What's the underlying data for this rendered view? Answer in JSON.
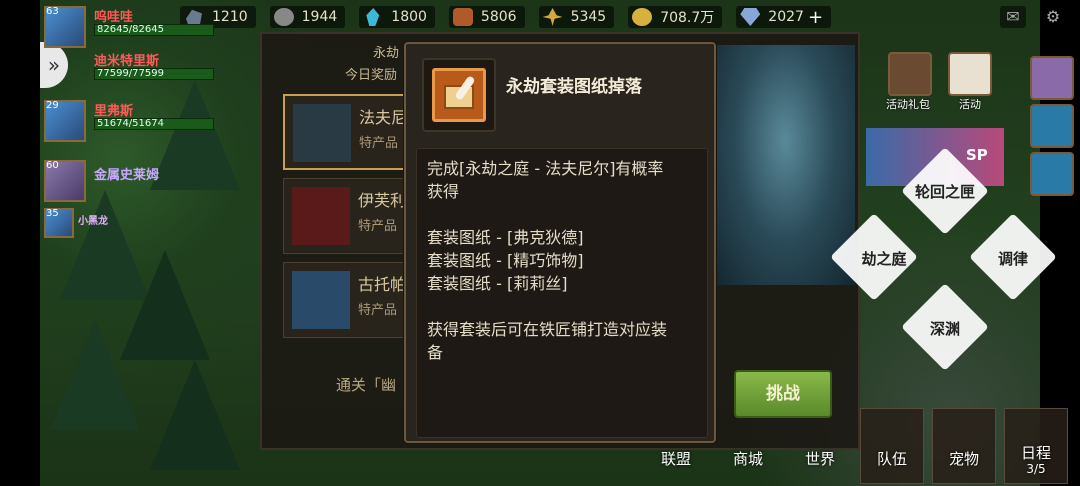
{
  "resources": [
    {
      "icon": "stone-icon",
      "value": "1210"
    },
    {
      "icon": "ore-icon",
      "value": "1944"
    },
    {
      "icon": "crystal-icon",
      "value": "1800"
    },
    {
      "icon": "wood-icon",
      "value": "5806"
    },
    {
      "icon": "wheat-icon",
      "value": "5345"
    },
    {
      "icon": "gold-icon",
      "value": "708.7万"
    },
    {
      "icon": "gem-icon",
      "value": "2027"
    }
  ],
  "party": [
    {
      "level": "63",
      "name": "呜哇哇",
      "hp": "82645/82645"
    },
    {
      "level": "",
      "name": "迪米特里斯",
      "hp": "77599/77599"
    },
    {
      "level": "29",
      "name": "里弗斯",
      "hp": "51674/51674"
    },
    {
      "level": "60",
      "name": "金属史莱姆",
      "hp": ""
    },
    {
      "level": "35",
      "name": "小黑龙",
      "hp": ""
    }
  ],
  "background_panel": {
    "title": "永劫",
    "subtitle": "今日奖励",
    "items": [
      {
        "name": "法夫尼",
        "sub": "特产品"
      },
      {
        "name": "伊芙利",
        "sub": "特产品"
      },
      {
        "name": "古托帕",
        "sub": "特产品"
      }
    ],
    "clear_text": "通关「幽",
    "challenge_label": "挑战"
  },
  "tooltip": {
    "title": "永劫套装图纸掉落",
    "icon": "blueprint-book-icon",
    "lines": [
      "完成[永劫之庭 - 法夫尼尔]有概率",
      "获得",
      "",
      "套装图纸 - [弗克狄德]",
      "套装图纸 - [精巧饰物]",
      "套装图纸 - [莉莉丝]",
      "",
      "获得套装后可在铁匠铺打造对应装",
      "备"
    ]
  },
  "right_panel": {
    "event_gift": "活动礼包",
    "event": "活动",
    "sp_text": "SP",
    "diamond_buttons": [
      "轮回之匣",
      "劫之庭",
      "调律",
      "深渊"
    ]
  },
  "bottom_nav": [
    "联盟",
    "商城",
    "世界",
    "队伍",
    "宠物",
    "日程"
  ],
  "schedule_count": "3/5",
  "colors": {
    "panel_bg": "#2a241e",
    "accent_border": "#6a5840",
    "challenge_green": "#7aa83a",
    "player_name_red": "#ff5a5a"
  }
}
